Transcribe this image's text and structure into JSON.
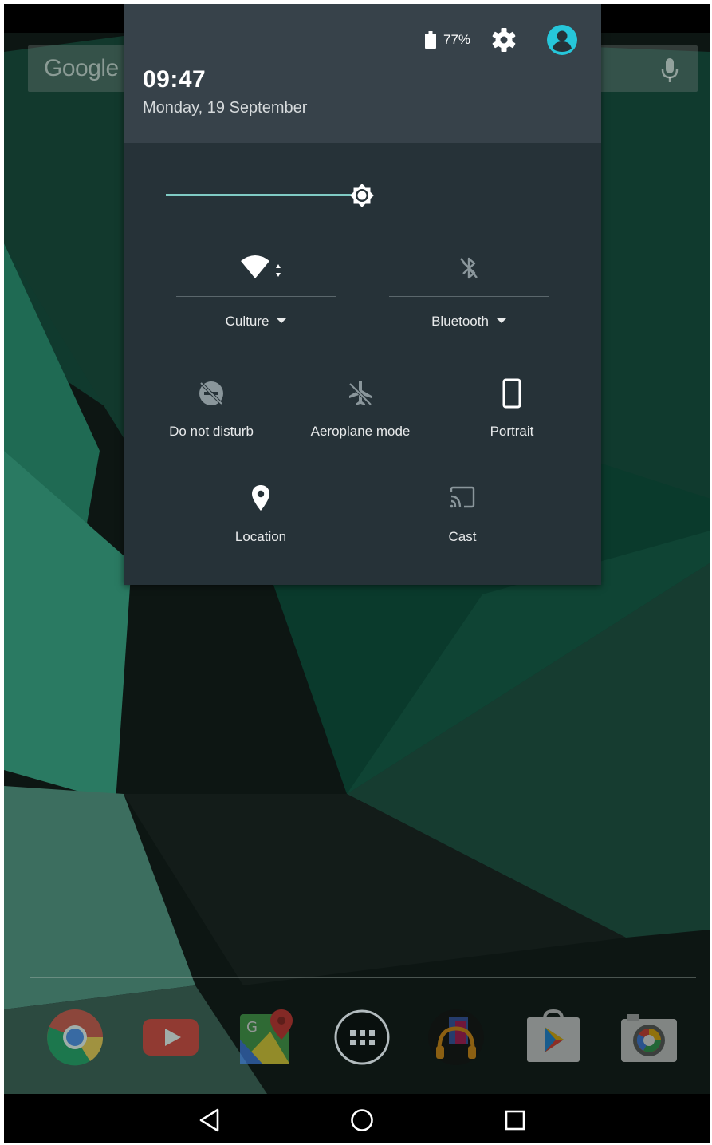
{
  "status_bar": {
    "battery_percent": "77%",
    "icons": [
      "battery-icon",
      "gear-icon",
      "account-icon"
    ]
  },
  "header": {
    "time": "09:47",
    "date": "Monday, 19 September"
  },
  "brightness": {
    "level": 0.5
  },
  "tiles": {
    "wifi": {
      "label": "Culture",
      "icon": "wifi-icon",
      "has_dropdown": true
    },
    "bluetooth": {
      "label": "Bluetooth",
      "icon": "bluetooth-off-icon",
      "has_dropdown": true
    },
    "dnd": {
      "label": "Do not disturb",
      "icon": "do-not-disturb-off-icon"
    },
    "aeroplane": {
      "label": "Aeroplane mode",
      "icon": "airplane-off-icon"
    },
    "rotation": {
      "label": "Portrait",
      "icon": "portrait-phone-icon"
    },
    "location": {
      "label": "Location",
      "icon": "location-pin-icon"
    },
    "cast": {
      "label": "Cast",
      "icon": "cast-icon"
    }
  },
  "home_screen": {
    "search_logo": "Google",
    "dock_apps": [
      "chrome-icon",
      "youtube-icon",
      "maps-icon",
      "app-drawer-icon",
      "music-icon",
      "play-store-icon",
      "camera-icon"
    ]
  },
  "navigation": {
    "buttons": [
      "back-icon",
      "home-icon",
      "recents-icon"
    ]
  },
  "colors": {
    "panel": "#263238",
    "header": "#37424a",
    "accent": "#80cbc4",
    "avatar": "#26c6da"
  }
}
